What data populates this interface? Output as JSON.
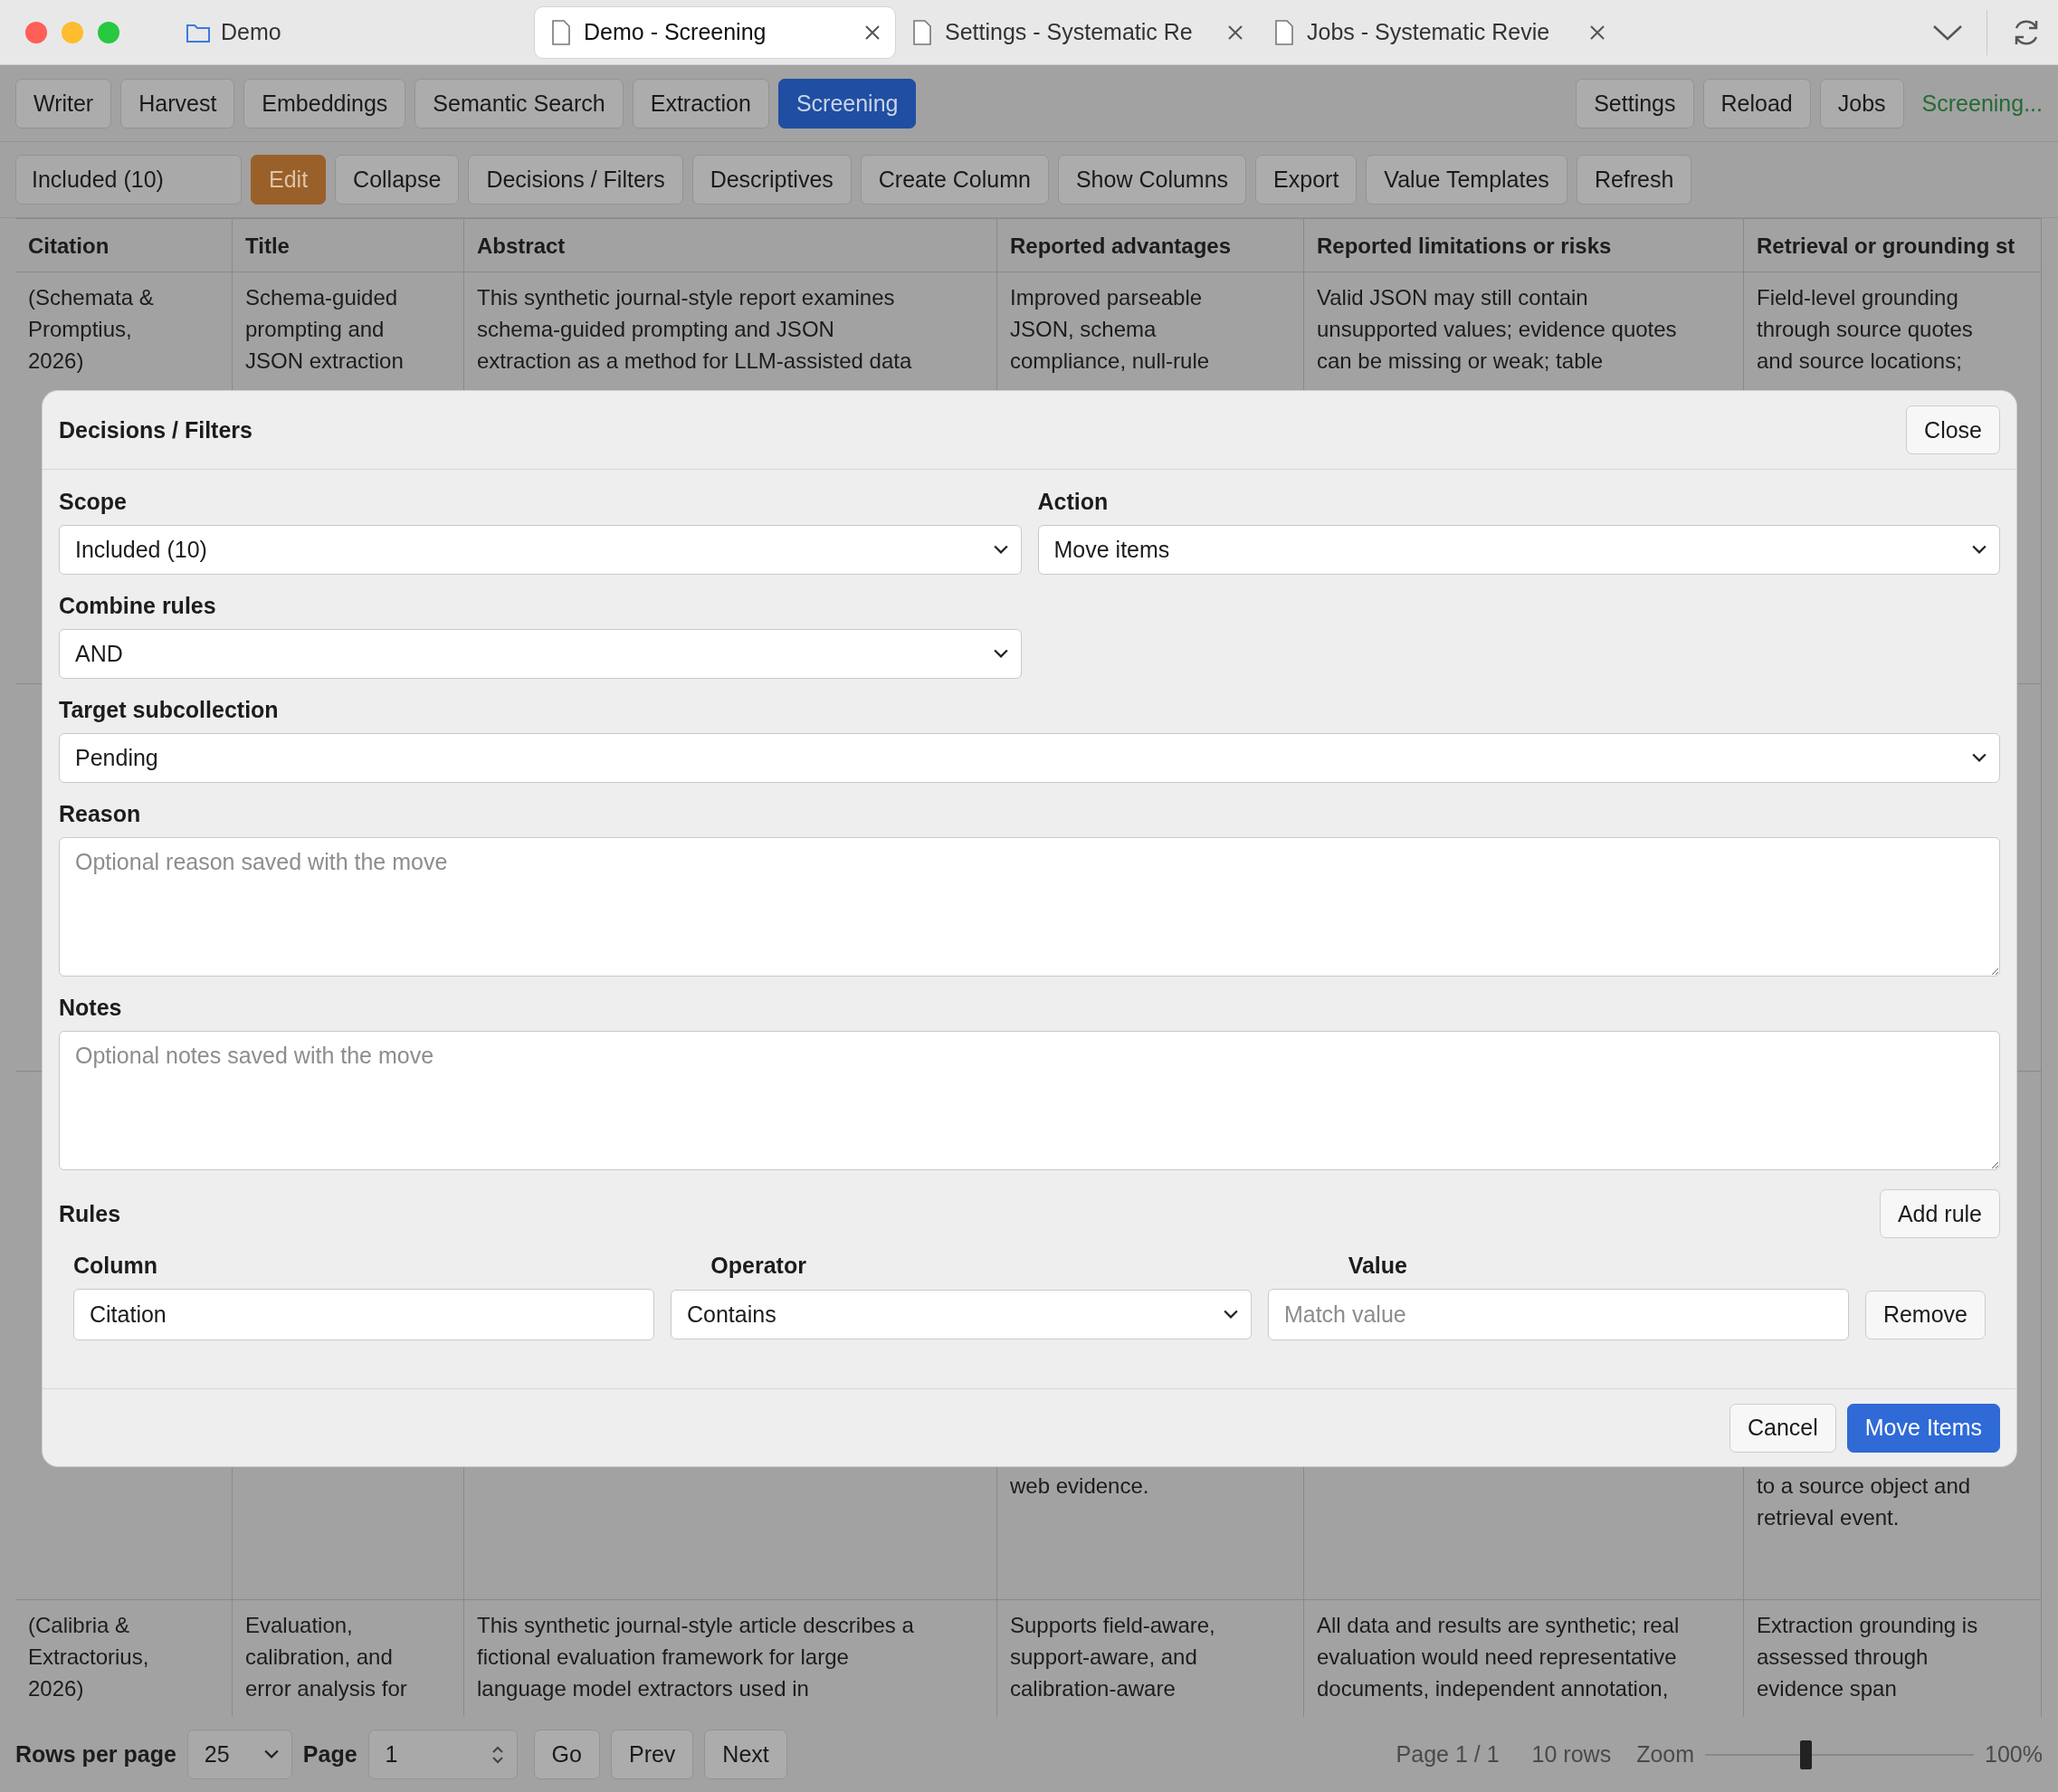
{
  "browser": {
    "tabs": [
      {
        "label": "Demo",
        "kind": "folder",
        "selected": false
      },
      {
        "label": "Demo - Screening",
        "kind": "page",
        "selected": true
      },
      {
        "label": "Settings - Systematic Re",
        "kind": "page",
        "selected": false
      },
      {
        "label": "Jobs - Systematic Revie",
        "kind": "page",
        "selected": false
      }
    ]
  },
  "nav": {
    "left": [
      {
        "label": "Writer",
        "selected": false
      },
      {
        "label": "Harvest",
        "selected": false
      },
      {
        "label": "Embeddings",
        "selected": false
      },
      {
        "label": "Semantic Search",
        "selected": false
      },
      {
        "label": "Extraction",
        "selected": false
      },
      {
        "label": "Screening",
        "selected": true
      }
    ],
    "right": [
      "Settings",
      "Reload",
      "Jobs"
    ],
    "status": "Screening..."
  },
  "toolbar": {
    "scope": "Included (10)",
    "buttons": [
      {
        "label": "Edit",
        "kind": "accent"
      },
      {
        "label": "Collapse",
        "kind": "plain"
      },
      {
        "label": "Decisions / Filters",
        "kind": "plain"
      },
      {
        "label": "Descriptives",
        "kind": "plain"
      },
      {
        "label": "Create Column",
        "kind": "plain"
      },
      {
        "label": "Show Columns",
        "kind": "plain"
      },
      {
        "label": "Export",
        "kind": "plain"
      },
      {
        "label": "Value Templates",
        "kind": "plain"
      },
      {
        "label": "Refresh",
        "kind": "plain"
      }
    ]
  },
  "table": {
    "columns": [
      "Citation",
      "Title",
      "Abstract",
      "Reported advantages",
      "Reported limitations or risks",
      "Retrieval or grounding st"
    ],
    "rows": [
      {
        "cells": [
          "(Schemata &\nPromptius,\n2026)",
          "Schema-guided\nprompting and\nJSON extraction",
          "This synthetic journal-style report examines\nschema-guided prompting and JSON\nextraction as a method for LLM-assisted data",
          "Improved parseable\nJSON, schema\ncompliance, null-rule",
          "Valid JSON may still contain\nunsupported values; evidence quotes\ncan be missing or weak; table",
          "Field-level grounding\nthrough source quotes\nand source locations;"
        ]
      },
      {
        "cells": [
          null,
          null,
          null,
          null,
          null,
          null
        ]
      },
      {
        "cells": [
          null,
          null,
          null,
          "web evidence.",
          null,
          "to a source object and\nretrieval event."
        ]
      },
      {
        "cells": [
          "(Calibria &\nExtractorius,\n2026)",
          "Evaluation,\ncalibration, and\nerror analysis for",
          "This synthetic journal-style article describes a\nfictional evaluation framework for large\nlanguage model extractors used in",
          "Supports field-aware,\nsupport-aware, and\ncalibration-aware",
          "All data and results are synthetic; real\nevaluation would need representative\ndocuments, independent annotation,",
          "Extraction grounding is\nassessed through\nevidence span"
        ]
      }
    ]
  },
  "dialog": {
    "title": "Decisions / Filters",
    "close": "Close",
    "scope": {
      "label": "Scope",
      "value": "Included (10)"
    },
    "action": {
      "label": "Action",
      "value": "Move items"
    },
    "combine": {
      "label": "Combine rules",
      "value": "AND"
    },
    "target": {
      "label": "Target subcollection",
      "value": "Pending"
    },
    "reason": {
      "label": "Reason",
      "placeholder": "Optional reason saved with the move"
    },
    "notes": {
      "label": "Notes",
      "placeholder": "Optional notes saved with the move"
    },
    "rules": {
      "label": "Rules",
      "add": "Add rule",
      "headers": [
        "Column",
        "Operator",
        "Value"
      ],
      "items": [
        {
          "column": "Citation",
          "operator": "Contains",
          "placeholder": "Match value",
          "remove": "Remove"
        }
      ]
    },
    "cancel": "Cancel",
    "confirm": "Move Items"
  },
  "footer": {
    "rows_label": "Rows per page",
    "rows_value": "25",
    "page_label": "Page",
    "page_value": "1",
    "buttons": [
      "Go",
      "Prev",
      "Next"
    ],
    "page_info": "Page 1 / 1",
    "row_count": "10 rows",
    "zoom_label": "Zoom",
    "zoom": {
      "level": 0.375
    },
    "zoom_value": "100%"
  }
}
